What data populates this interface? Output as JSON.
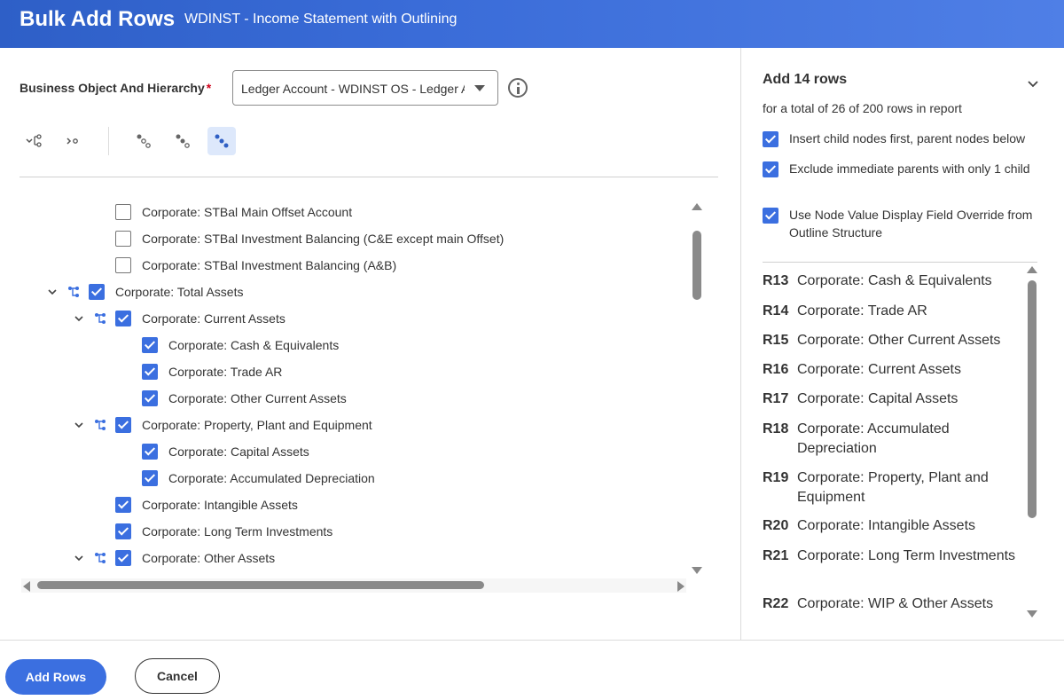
{
  "header": {
    "title": "Bulk Add Rows",
    "subtitle": "WDINST - Income Statement with Outlining"
  },
  "form": {
    "business_object_label": "Business Object And Hierarchy",
    "required_marker": "*",
    "business_object_value": "Ledger Account - WDINST OS - Ledger A",
    "info_icon": "info-icon"
  },
  "toolbar": {
    "buttons": [
      "expand-hierarchy-icon",
      "collapse-hierarchy-icon",
      "select-level-1-icon",
      "select-level-2-icon",
      "select-level-3-icon"
    ],
    "active_button": "select-level-3-icon"
  },
  "tree": {
    "rows": [
      {
        "label": "Corporate: STBal Main Offset Account",
        "checked": false,
        "level": 2,
        "expandable": false
      },
      {
        "label": "Corporate: STBal Investment Balancing (C&E except main Offset)",
        "checked": false,
        "level": 2,
        "expandable": false
      },
      {
        "label": "Corporate: STBal Investment Balancing (A&B)",
        "checked": false,
        "level": 2,
        "expandable": false
      },
      {
        "label": "Corporate: Total Assets",
        "checked": true,
        "level": 1,
        "expandable": true
      },
      {
        "label": "Corporate: Current Assets",
        "checked": true,
        "level": 2,
        "expandable": true
      },
      {
        "label": "Corporate: Cash & Equivalents",
        "checked": true,
        "level": 3,
        "expandable": false
      },
      {
        "label": "Corporate: Trade AR",
        "checked": true,
        "level": 3,
        "expandable": false
      },
      {
        "label": "Corporate: Other Current Assets",
        "checked": true,
        "level": 3,
        "expandable": false
      },
      {
        "label": "Corporate: Property, Plant and Equipment",
        "checked": true,
        "level": 2,
        "expandable": true
      },
      {
        "label": "Corporate: Capital Assets",
        "checked": true,
        "level": 3,
        "expandable": false
      },
      {
        "label": "Corporate: Accumulated Depreciation",
        "checked": true,
        "level": 3,
        "expandable": false
      },
      {
        "label": "Corporate: Intangible Assets",
        "checked": true,
        "level": 2,
        "expandable": false
      },
      {
        "label": "Corporate: Long Term Investments",
        "checked": true,
        "level": 2,
        "expandable": false
      },
      {
        "label": "Corporate: Other Assets",
        "checked": true,
        "level": 2,
        "expandable": true
      },
      {
        "label": "Corporate: WIP & Other Assets",
        "checked": true,
        "level": 3,
        "expandable": false
      }
    ]
  },
  "summary": {
    "title": "Add 14 rows",
    "total_text": "for a total of 26 of 200 rows in report",
    "options": [
      {
        "label": "Insert child nodes first, parent nodes below",
        "checked": true
      },
      {
        "label": "Exclude immediate parents with only 1 child",
        "checked": true
      },
      {
        "label": "Use Node Value Display Field Override from Outline Structure",
        "checked": true
      }
    ],
    "rows": [
      {
        "num": "R13",
        "name": "Corporate: Cash & Equivalents"
      },
      {
        "num": "R14",
        "name": "Corporate: Trade AR"
      },
      {
        "num": "R15",
        "name": "Corporate: Other Current Assets"
      },
      {
        "num": "R16",
        "name": "Corporate: Current Assets"
      },
      {
        "num": "R17",
        "name": "Corporate: Capital Assets"
      },
      {
        "num": "R18",
        "name": "Corporate: Accumulated Depreciation"
      },
      {
        "num": "R19",
        "name": "Corporate: Property, Plant and Equipment"
      },
      {
        "num": "R20",
        "name": "Corporate: Intangible Assets"
      },
      {
        "num": "R21",
        "name": "Corporate: Long Term Investments"
      },
      {
        "num": "R22",
        "name": "Corporate: WIP & Other Assets"
      }
    ]
  },
  "footer": {
    "add_rows_label": "Add Rows",
    "cancel_label": "Cancel"
  },
  "colors": {
    "accent": "#3b6fe0",
    "header_start": "#2e5fc7",
    "header_end": "#4f7fe6",
    "active_toolbar_bg": "#dde8fb"
  }
}
